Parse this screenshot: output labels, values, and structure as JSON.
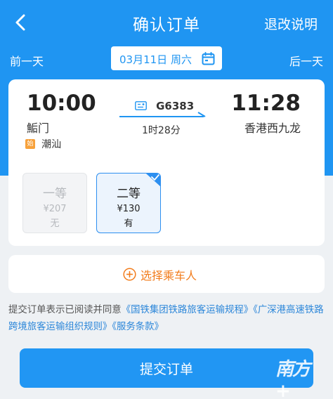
{
  "header": {
    "title": "确认订单",
    "refund_link": "退改说明",
    "back_icon": "chevron-left-icon"
  },
  "datebar": {
    "prev_day": "前一天",
    "date": "03月11日 周六",
    "next_day": "后一天",
    "calendar_icon": "calendar-icon"
  },
  "trip": {
    "departure_time": "10:00",
    "departure_station": "鮜门",
    "origin_badge": "始",
    "origin_station": "潮汕",
    "train_number": "G6383",
    "duration": "1时28分",
    "arrival_time": "11:28",
    "arrival_station": "香港西九龙"
  },
  "seats": [
    {
      "name": "一等",
      "price": "¥207",
      "availability": "无",
      "selected": false
    },
    {
      "name": "二等",
      "price": "¥130",
      "availability": "有",
      "selected": true
    }
  ],
  "passenger": {
    "label": "选择乘车人",
    "icon": "plus-circle-icon"
  },
  "agreement": {
    "prefix": "提交订单表示已阅读并同意",
    "link1": "《国铁集团铁路旅客运输规程》",
    "link2": "《广深港高速铁路跨境旅客运输组织规则》",
    "link3": "《服务条款》"
  },
  "submit": {
    "label": "提交订单"
  },
  "watermark": {
    "text": "南方+"
  },
  "colors": {
    "primary": "#1f95f2",
    "accent_orange": "#f27c1c",
    "link_blue": "#2b86d9"
  }
}
